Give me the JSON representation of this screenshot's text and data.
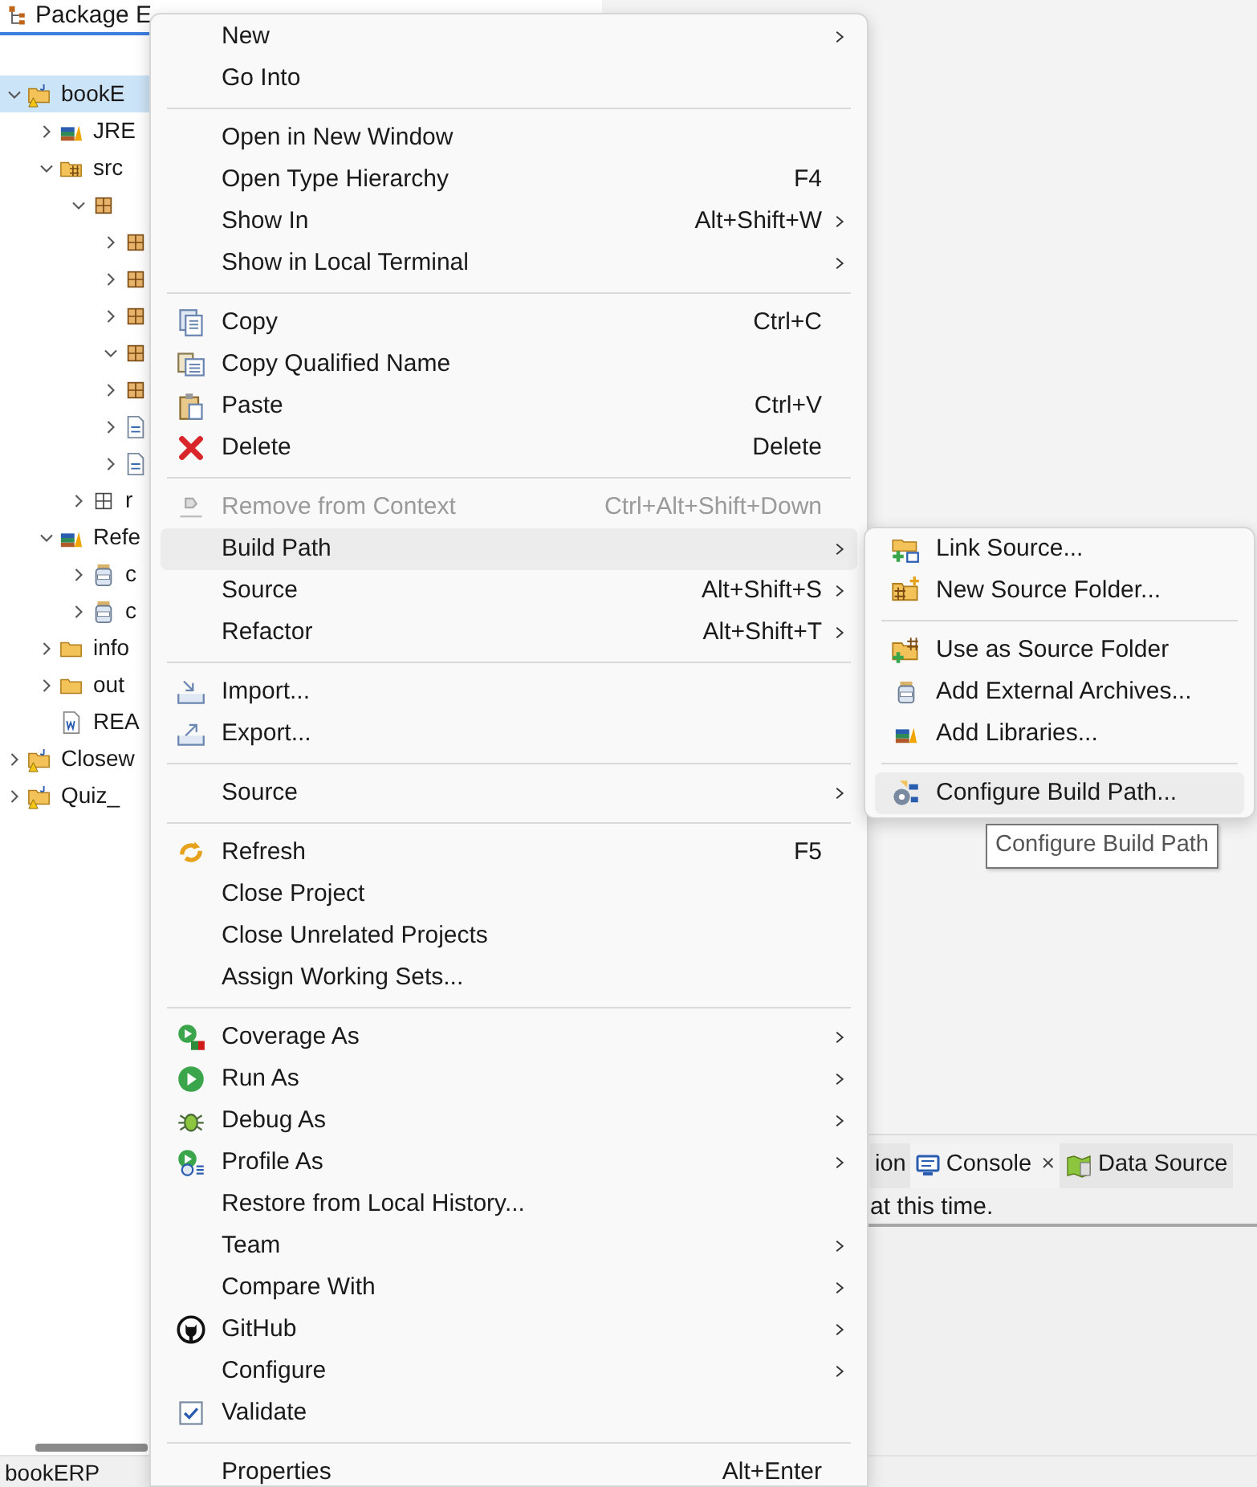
{
  "explorer": {
    "tab": "Package E",
    "tree": [
      {
        "label": "bookE",
        "kind": "project",
        "expanded": true,
        "selected": true,
        "children": [
          {
            "label": "JRE",
            "kind": "library",
            "expanded": false,
            "selected": false
          },
          {
            "label": "src",
            "kind": "source_folder",
            "expanded": true,
            "selected": false,
            "children": [
              {
                "kind": "package",
                "expanded": true,
                "selected": false,
                "children": [
                  {
                    "kind": "package",
                    "expanded": false,
                    "selected": false
                  },
                  {
                    "kind": "package",
                    "expanded": false,
                    "selected": false
                  },
                  {
                    "kind": "package",
                    "expanded": false,
                    "selected": false
                  },
                  {
                    "kind": "package",
                    "expanded": true,
                    "selected": false
                  },
                  {
                    "kind": "package",
                    "expanded": false,
                    "selected": false
                  },
                  {
                    "kind": "file",
                    "expanded": false,
                    "selected": false
                  },
                  {
                    "kind": "file",
                    "expanded": false,
                    "selected": false
                  }
                ]
              },
              {
                "label": "r",
                "kind": "outline_package",
                "expanded": false,
                "selected": false
              }
            ]
          },
          {
            "label": "Refe",
            "kind": "library",
            "expanded": true,
            "selected": false,
            "children": [
              {
                "label": "c",
                "kind": "jar",
                "expanded": false,
                "selected": false
              },
              {
                "label": "c",
                "kind": "jar",
                "expanded": false,
                "selected": false
              }
            ]
          },
          {
            "label": "info",
            "kind": "folder",
            "expanded": false,
            "selected": false
          },
          {
            "label": "out",
            "kind": "folder",
            "expanded": false,
            "selected": false
          },
          {
            "label": "REA",
            "kind": "document",
            "selected": false
          }
        ]
      },
      {
        "label": "Closew",
        "kind": "project",
        "expanded": false,
        "selected": false
      },
      {
        "label": "Quiz_",
        "kind": "project",
        "expanded": false,
        "selected": false
      }
    ]
  },
  "bottom_panel": {
    "tabs": [
      {
        "label": "ion",
        "selected": false
      },
      {
        "label": "Console",
        "close": "×",
        "selected": true
      },
      {
        "label": "Data Source",
        "selected": false
      }
    ],
    "message": "at this time."
  },
  "status_bar": "bookERP",
  "context_menu": {
    "items": [
      {
        "kind": "item",
        "label": "New",
        "submenu": true,
        "disabled": false,
        "selected": false
      },
      {
        "kind": "item",
        "label": "Go Into",
        "submenu": false,
        "disabled": false,
        "selected": false
      },
      {
        "kind": "separator"
      },
      {
        "kind": "item",
        "label": "Open in New Window",
        "submenu": false,
        "disabled": false,
        "selected": false
      },
      {
        "kind": "item",
        "label": "Open Type Hierarchy",
        "shortcut": "F4",
        "submenu": false,
        "disabled": false,
        "selected": false
      },
      {
        "kind": "item",
        "label": "Show In",
        "shortcut": "Alt+Shift+W",
        "submenu": true,
        "disabled": false,
        "selected": false
      },
      {
        "kind": "item",
        "label": "Show in Local Terminal",
        "submenu": true,
        "disabled": false,
        "selected": false
      },
      {
        "kind": "separator"
      },
      {
        "kind": "item",
        "label": "Copy",
        "shortcut": "Ctrl+C",
        "submenu": false,
        "disabled": false,
        "selected": false
      },
      {
        "kind": "item",
        "label": "Copy Qualified Name",
        "submenu": false,
        "disabled": false,
        "selected": false
      },
      {
        "kind": "item",
        "label": "Paste",
        "shortcut": "Ctrl+V",
        "submenu": false,
        "disabled": false,
        "selected": false
      },
      {
        "kind": "item",
        "label": "Delete",
        "shortcut": "Delete",
        "submenu": false,
        "disabled": false,
        "selected": false
      },
      {
        "kind": "separator"
      },
      {
        "kind": "item",
        "label": "Remove from Context",
        "shortcut": "Ctrl+Alt+Shift+Down",
        "submenu": false,
        "disabled": true,
        "selected": false
      },
      {
        "kind": "item",
        "label": "Build Path",
        "submenu": true,
        "disabled": false,
        "selected": true
      },
      {
        "kind": "item",
        "label": "Source",
        "shortcut": "Alt+Shift+S",
        "submenu": true,
        "disabled": false,
        "selected": false
      },
      {
        "kind": "item",
        "label": "Refactor",
        "shortcut": "Alt+Shift+T",
        "submenu": true,
        "disabled": false,
        "selected": false
      },
      {
        "kind": "separator"
      },
      {
        "kind": "item",
        "label": "Import...",
        "submenu": false,
        "disabled": false,
        "selected": false
      },
      {
        "kind": "item",
        "label": "Export...",
        "submenu": false,
        "disabled": false,
        "selected": false
      },
      {
        "kind": "separator"
      },
      {
        "kind": "item",
        "label": "Source",
        "submenu": true,
        "disabled": false,
        "selected": false
      },
      {
        "kind": "separator"
      },
      {
        "kind": "item",
        "label": "Refresh",
        "shortcut": "F5",
        "submenu": false,
        "disabled": false,
        "selected": false
      },
      {
        "kind": "item",
        "label": "Close Project",
        "submenu": false,
        "disabled": false,
        "selected": false
      },
      {
        "kind": "item",
        "label": "Close Unrelated Projects",
        "submenu": false,
        "disabled": false,
        "selected": false
      },
      {
        "kind": "item",
        "label": "Assign Working Sets...",
        "submenu": false,
        "disabled": false,
        "selected": false
      },
      {
        "kind": "separator"
      },
      {
        "kind": "item",
        "label": "Coverage As",
        "submenu": true,
        "disabled": false,
        "selected": false
      },
      {
        "kind": "item",
        "label": "Run As",
        "submenu": true,
        "disabled": false,
        "selected": false
      },
      {
        "kind": "item",
        "label": "Debug As",
        "submenu": true,
        "disabled": false,
        "selected": false
      },
      {
        "kind": "item",
        "label": "Profile As",
        "submenu": true,
        "disabled": false,
        "selected": false
      },
      {
        "kind": "item",
        "label": "Restore from Local History...",
        "submenu": false,
        "disabled": false,
        "selected": false
      },
      {
        "kind": "item",
        "label": "Team",
        "submenu": true,
        "disabled": false,
        "selected": false
      },
      {
        "kind": "item",
        "label": "Compare With",
        "submenu": true,
        "disabled": false,
        "selected": false
      },
      {
        "kind": "item",
        "label": "GitHub",
        "submenu": true,
        "disabled": false,
        "selected": false
      },
      {
        "kind": "item",
        "label": "Configure",
        "submenu": true,
        "disabled": false,
        "selected": false
      },
      {
        "kind": "item",
        "label": "Validate",
        "submenu": false,
        "disabled": false,
        "selected": false
      },
      {
        "kind": "separator"
      },
      {
        "kind": "item",
        "label": "Properties",
        "shortcut": "Alt+Enter",
        "submenu": false,
        "disabled": false,
        "selected": false
      }
    ]
  },
  "build_path_submenu": {
    "items": [
      {
        "kind": "item",
        "label": "Link Source...",
        "selected": false
      },
      {
        "kind": "item",
        "label": "New Source Folder...",
        "selected": false
      },
      {
        "kind": "separator"
      },
      {
        "kind": "item",
        "label": "Use as Source Folder",
        "selected": false
      },
      {
        "kind": "item",
        "label": "Add External Archives...",
        "selected": false
      },
      {
        "kind": "item",
        "label": "Add Libraries...",
        "selected": false
      },
      {
        "kind": "separator"
      },
      {
        "kind": "item",
        "label": "Configure Build Path...",
        "selected": true
      }
    ]
  },
  "tooltip": "Configure Build Path"
}
